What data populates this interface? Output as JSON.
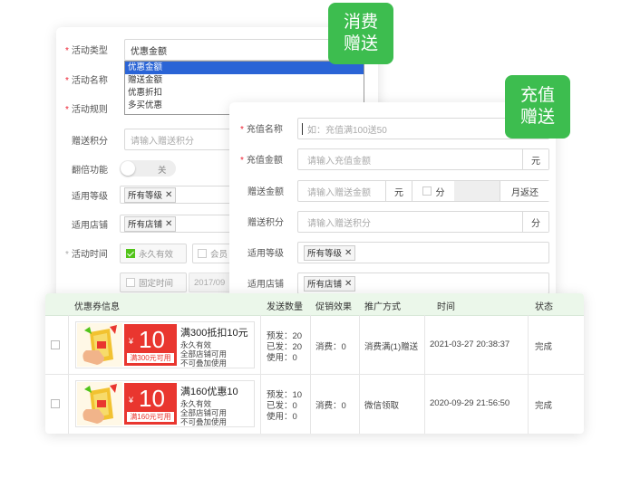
{
  "badges": {
    "consume": [
      "消费",
      "赠送"
    ],
    "recharge": [
      "充值",
      "赠送"
    ]
  },
  "activity_form": {
    "type": {
      "label": "活动类型",
      "value": "优惠金额",
      "options": [
        "优惠金额",
        "赠送金额",
        "优惠折扣",
        "多买优惠"
      ]
    },
    "name_label": "活动名称",
    "rule_label": "活动规则",
    "points": {
      "label": "赠送积分",
      "placeholder": "请输入赠送积分"
    },
    "double": {
      "label": "翻倍功能",
      "value": "关"
    },
    "level": {
      "label": "适用等级",
      "tag": "所有等级"
    },
    "store": {
      "label": "适用店铺",
      "tag": "所有店铺"
    },
    "time": {
      "label": "活动时间",
      "permanent": "永久有效",
      "member": "会员",
      "fixed": "固定时间",
      "date": "2017/09"
    }
  },
  "recharge_form": {
    "name": {
      "label": "充值名称",
      "placeholder": "如：充值满100送50"
    },
    "amount": {
      "label": "充值金额",
      "placeholder": "请输入充值金额",
      "unit": "元"
    },
    "gift": {
      "label": "赠送金额",
      "placeholder": "请输入赠送金额",
      "unit": "元",
      "points_unit": "分",
      "monthly": "月返还"
    },
    "points": {
      "label": "赠送积分",
      "placeholder": "请输入赠送积分",
      "unit": "分"
    },
    "level": {
      "label": "适用等级",
      "tag": "所有等级"
    },
    "store": {
      "label": "适用店铺",
      "tag": "所有店铺"
    }
  },
  "table": {
    "headers": [
      "优惠券信息",
      "发送数量",
      "促销效果",
      "推广方式",
      "时间",
      "状态"
    ],
    "rows": [
      {
        "coupon": {
          "currency": "¥",
          "amount": "10",
          "condition": "满300元可用",
          "title": "满300抵扣10元",
          "lines": [
            "永久有效",
            "全部店铺可用",
            "不可叠加使用"
          ]
        },
        "sent": [
          "预发：20",
          "已发：20",
          "使用：0"
        ],
        "effect": "消费：0",
        "promo": "消费满(1)赠送",
        "time": "2021-03-27 20:38:37",
        "status": "完成"
      },
      {
        "coupon": {
          "currency": "¥",
          "amount": "10",
          "condition": "满160元可用",
          "title": "满160优惠10",
          "lines": [
            "永久有效",
            "全部店铺可用",
            "不可叠加使用"
          ]
        },
        "sent": [
          "预发：10",
          "已发：0",
          "使用：0"
        ],
        "effect": "消费：0",
        "promo": "微信领取",
        "time": "2020-09-29 21:56:50",
        "status": "完成"
      }
    ]
  }
}
